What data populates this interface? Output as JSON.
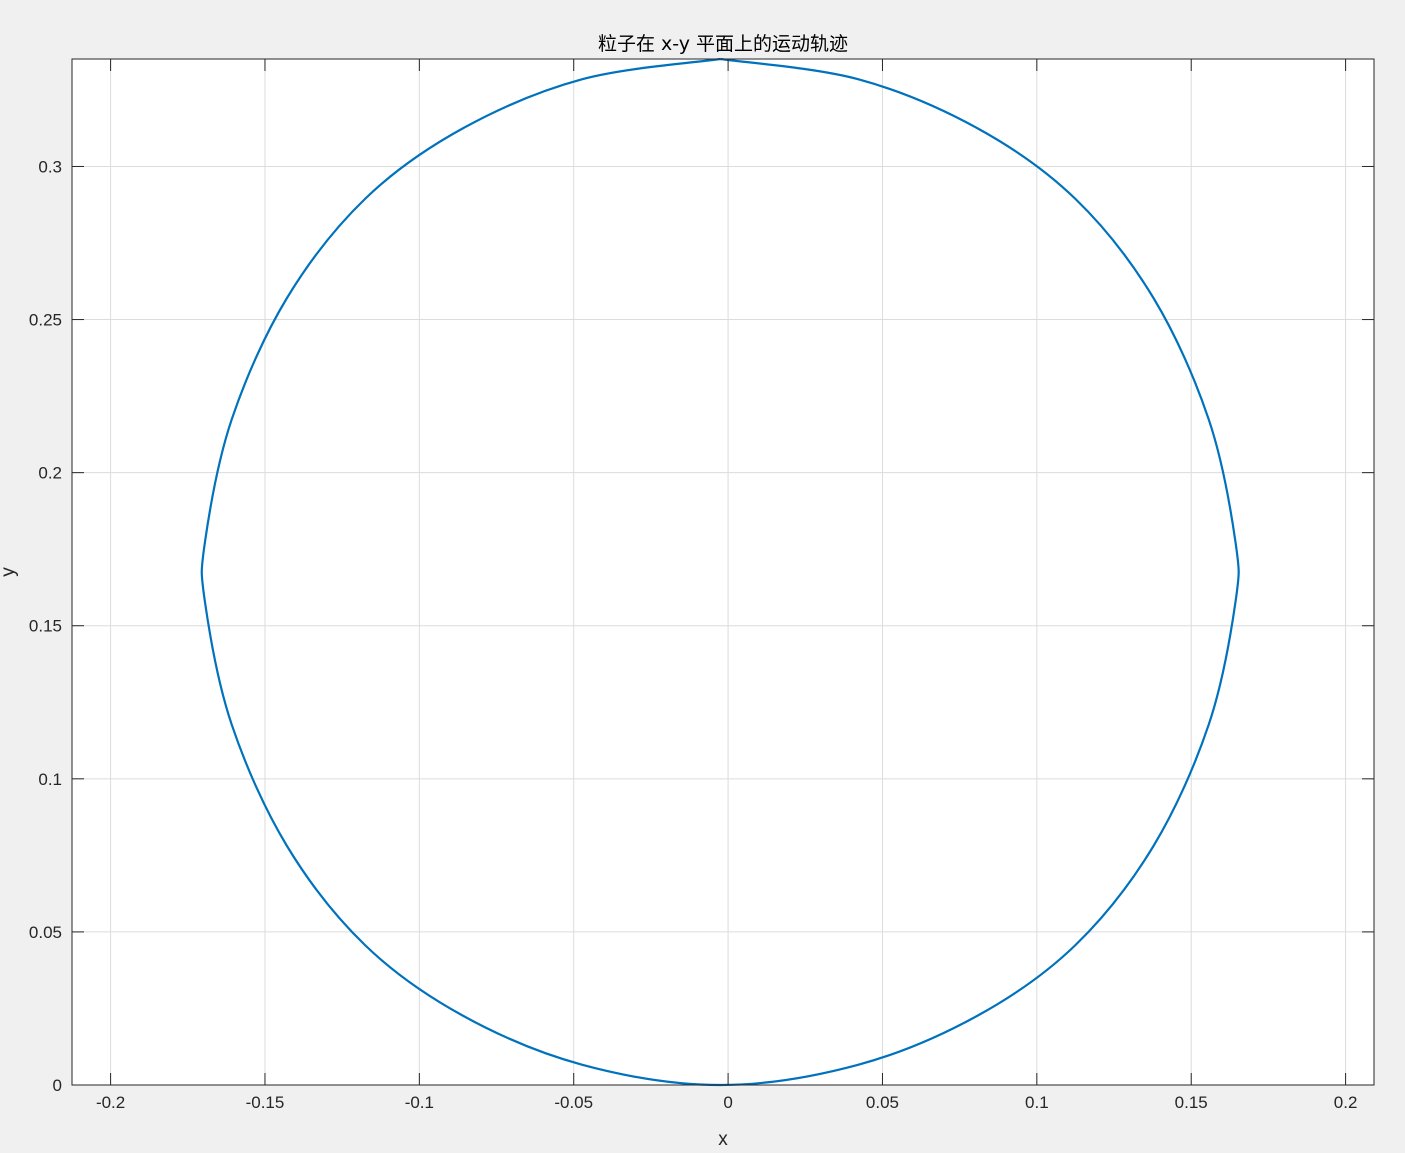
{
  "chart_data": {
    "type": "line",
    "title": "粒子在 x-y 平面上的运动轨迹",
    "xlabel": "x",
    "ylabel": "y",
    "xlim": [
      -0.2125,
      0.2092
    ],
    "ylim": [
      0,
      0.3351
    ],
    "grid": true,
    "x_ticks": [
      {
        "value": -0.2,
        "label": "-0.2"
      },
      {
        "value": -0.15,
        "label": "-0.15"
      },
      {
        "value": -0.1,
        "label": "-0.1"
      },
      {
        "value": -0.05,
        "label": "-0.05"
      },
      {
        "value": 0,
        "label": "0"
      },
      {
        "value": 0.05,
        "label": "0.05"
      },
      {
        "value": 0.1,
        "label": "0.1"
      },
      {
        "value": 0.15,
        "label": "0.15"
      },
      {
        "value": 0.2,
        "label": "0.2"
      }
    ],
    "y_ticks": [
      {
        "value": 0,
        "label": "0"
      },
      {
        "value": 0.05,
        "label": "0.05"
      },
      {
        "value": 0.1,
        "label": "0.1"
      },
      {
        "value": 0.15,
        "label": "0.15"
      },
      {
        "value": 0.2,
        "label": "0.2"
      },
      {
        "value": 0.25,
        "label": "0.25"
      },
      {
        "value": 0.3,
        "label": "0.3"
      }
    ],
    "series": [
      {
        "color": "#0072bd",
        "x": [
          -0.0025,
          0.0421,
          0.0809,
          0.1124,
          0.1378,
          0.1557,
          0.1643,
          0.1643,
          0.1557,
          0.1378,
          0.1124,
          0.0809,
          0.0421,
          -0.0025,
          -0.0472,
          -0.086,
          -0.1175,
          -0.1429,
          -0.1608,
          -0.1694,
          -0.1694,
          -0.1608,
          -0.1429,
          -0.1175,
          -0.086,
          -0.0472,
          -0.0025
        ],
        "y": [
          0.3351,
          0.3285,
          0.3124,
          0.2895,
          0.257,
          0.2173,
          0.1776,
          0.1575,
          0.1178,
          0.0781,
          0.0456,
          0.0227,
          0.0066,
          0.0,
          0.0066,
          0.0227,
          0.0456,
          0.0781,
          0.1178,
          0.1575,
          0.1776,
          0.2173,
          0.257,
          0.2895,
          0.3124,
          0.3285,
          0.3351
        ]
      }
    ]
  },
  "style": {
    "background": "#f0f0f0",
    "axes_background": "#ffffff",
    "axis_color": "#262626",
    "grid_color": "#dcdcdc"
  }
}
